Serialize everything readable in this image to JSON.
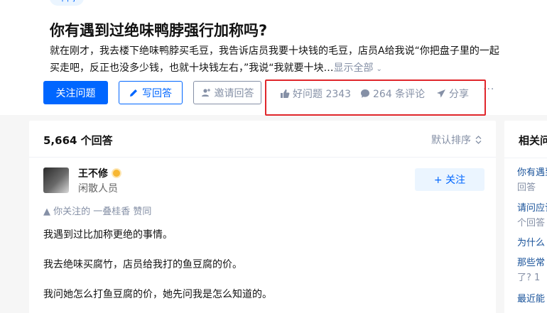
{
  "topic": {
    "label": "中间"
  },
  "question": {
    "title": "你有遇到过绝味鸭脖强行加称吗?",
    "detail_line1": "就在刚才，我去楼下绝味鸭脖买毛豆，我告诉店员我要十块钱的毛豆，店员A给我说“你把盘子里的一起",
    "detail_line2": "买走吧，反正也没多少钱，也就十块钱左右，”我说“我就要十块…",
    "show_all": "显示全部",
    "show_all_icon": "chevron-down-icon"
  },
  "actions": {
    "follow_label": "关注问题",
    "answer_label": "写回答",
    "invite_label": "邀请回答",
    "good_question": "好问题 2343",
    "comments": "264 条评论",
    "share": "分享",
    "more": "···"
  },
  "answers": {
    "count": "5,664 个回答",
    "sort": "默认排序"
  },
  "answer": {
    "author_name": "王不修",
    "author_bio": "闲散人员",
    "follow_label": "+ 关注",
    "upvote_info": "▲ 你关注的 一叠桂香 赞同",
    "paragraphs": [
      "我遇到过比加称更绝的事情。",
      "我去绝味买腐竹，店员给我打的鱼豆腐的价。",
      "我问她怎么打鱼豆腐的价，她先问我是怎么知道的。"
    ]
  },
  "sidebar": {
    "title": "相关问",
    "items": [
      {
        "q": "你有遇到",
        "meta": "回答"
      },
      {
        "q": "请问应该",
        "meta": "个回答"
      },
      {
        "q": "为什么",
        "meta": ""
      },
      {
        "q": "那些常",
        "meta": "了? 1"
      },
      {
        "q": "最近能",
        "meta": ""
      }
    ]
  },
  "colors": {
    "brand_blue": "#0066ff",
    "muted": "#8590a6",
    "highlight_red": "#e0262b"
  }
}
